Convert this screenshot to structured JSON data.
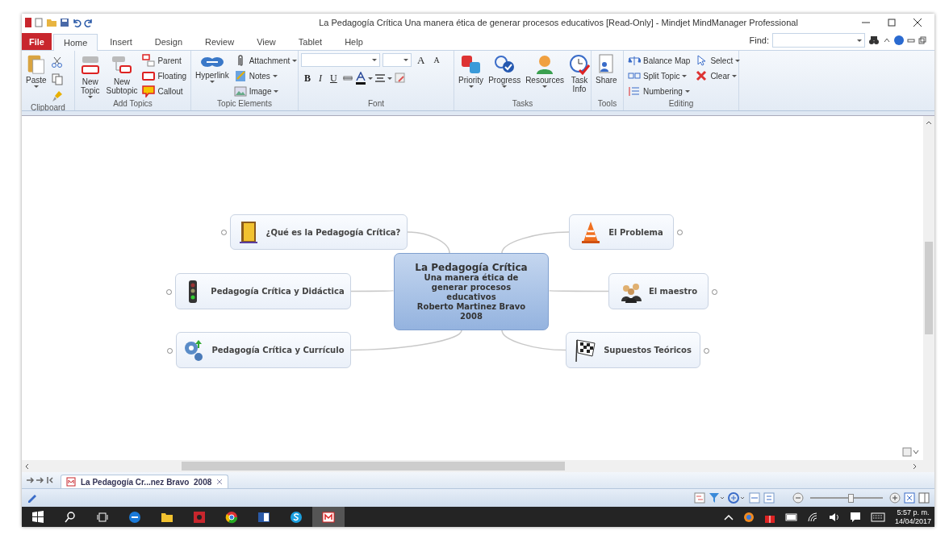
{
  "window": {
    "title": "La Pedagogía Crítica  Una manera ética de generar procesos educativos [Read-Only] - Mindjet MindManager Professional"
  },
  "menu_tabs": [
    {
      "label": "File",
      "kind": "file",
      "selected": false
    },
    {
      "label": "Home",
      "kind": "tab",
      "selected": true
    },
    {
      "label": "Insert",
      "kind": "tab",
      "selected": false
    },
    {
      "label": "Design",
      "kind": "tab",
      "selected": false
    },
    {
      "label": "Review",
      "kind": "tab",
      "selected": false
    },
    {
      "label": "View",
      "kind": "tab",
      "selected": false
    },
    {
      "label": "Tablet",
      "kind": "tab",
      "selected": false
    },
    {
      "label": "Help",
      "kind": "tab",
      "selected": false
    }
  ],
  "find": {
    "label": "Find:"
  },
  "ribbon": [
    {
      "name": "Clipboard",
      "items": [
        {
          "label": "Paste",
          "kind": "large",
          "dropdown": true
        }
      ]
    },
    {
      "name": "Add Topics",
      "items": [
        {
          "label": "New Topic",
          "kind": "large",
          "dropdown": true
        },
        {
          "label": "New Subtopic",
          "kind": "large",
          "dropdown": false
        },
        {
          "label": "Parent",
          "kind": "small",
          "dropdown": false
        },
        {
          "label": "Floating",
          "kind": "small",
          "dropdown": false
        },
        {
          "label": "Callout",
          "kind": "small",
          "dropdown": false
        }
      ]
    },
    {
      "name": "Topic Elements",
      "items": [
        {
          "label": "Hyperlink",
          "kind": "large",
          "dropdown": true
        },
        {
          "label": "Attachment",
          "kind": "small",
          "dropdown": true
        },
        {
          "label": "Notes",
          "kind": "small",
          "dropdown": true
        },
        {
          "label": "Image",
          "kind": "small",
          "dropdown": true
        }
      ]
    },
    {
      "name": "Font"
    },
    {
      "name": "Tasks",
      "items": [
        {
          "label": "Priority",
          "kind": "large",
          "dropdown": true
        },
        {
          "label": "Progress",
          "kind": "large",
          "dropdown": true
        },
        {
          "label": "Resources",
          "kind": "large",
          "dropdown": true
        },
        {
          "label": "Task Info",
          "kind": "large",
          "dropdown": false
        }
      ]
    },
    {
      "name": "Tools",
      "items": [
        {
          "label": "Share",
          "kind": "large",
          "dropdown": false
        }
      ]
    },
    {
      "name": "Editing",
      "items": [
        {
          "label": "Balance Map",
          "kind": "small",
          "dropdown": false
        },
        {
          "label": "Split Topic",
          "kind": "small",
          "dropdown": true
        },
        {
          "label": "Numbering",
          "kind": "small",
          "dropdown": true
        },
        {
          "label": "Select",
          "kind": "small",
          "dropdown": true
        },
        {
          "label": "Clear",
          "kind": "small",
          "dropdown": true
        }
      ]
    }
  ],
  "font": {
    "size_buttons": [
      "A",
      "A"
    ],
    "style_buttons": [
      "B",
      "I",
      "U"
    ]
  },
  "map": {
    "central": {
      "title": "La Pedagogía Crítica",
      "subtitle": "Una manera ética de generar procesos educativos",
      "author": "Roberto Martinez Bravo",
      "year": "2008"
    },
    "topics": [
      {
        "label": "¿Qué es la Pedagogía Crítica?",
        "collapsed": true
      },
      {
        "label": "Pedagogía Crítica y Didáctica",
        "collapsed": true
      },
      {
        "label": "Pedagogía Crítica y Currículo",
        "collapsed": true
      },
      {
        "label": "El Problema",
        "collapsed": true
      },
      {
        "label": "El maestro",
        "collapsed": true
      },
      {
        "label": "Supuestos Teóricos",
        "collapsed": true
      }
    ]
  },
  "doc_tabs": [
    {
      "label": "La Pedagogía Cr...nez Bravo  2008",
      "selected": true
    }
  ],
  "status_bar": {
    "zoom": {
      "level": 0.55
    }
  },
  "taskbar": {
    "apps": [
      {
        "selected": false
      },
      {
        "selected": false
      },
      {
        "selected": false
      },
      {
        "selected": false
      },
      {
        "selected": false
      },
      {
        "selected": false
      },
      {
        "selected": false
      },
      {
        "selected": true
      }
    ],
    "time": "5:57 p. m.",
    "date": "14/04/2017"
  }
}
